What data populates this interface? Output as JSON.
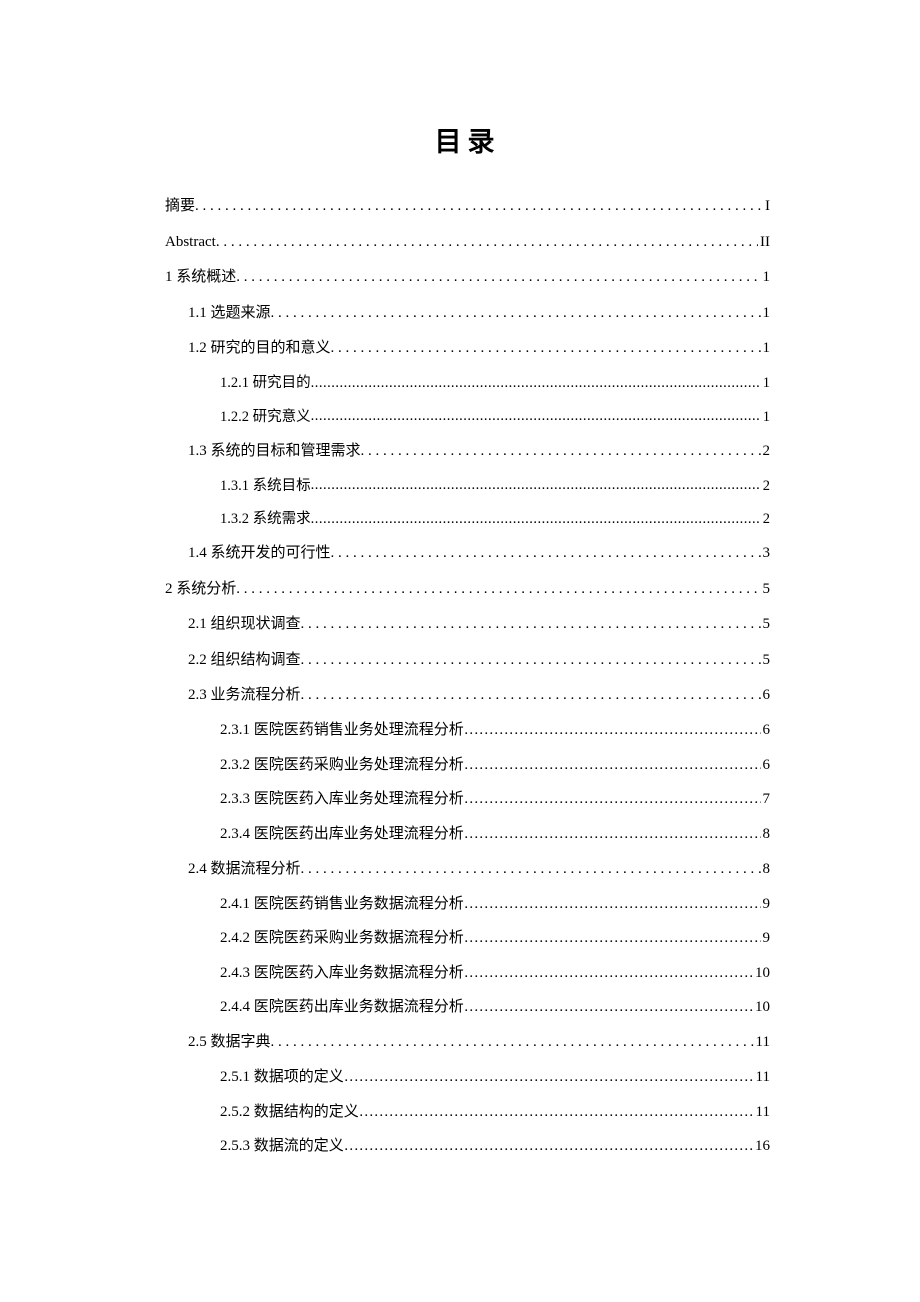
{
  "title": "目录",
  "entries": [
    {
      "label": "摘要",
      "page": "I",
      "level": "level-0",
      "leader": "leader-wide",
      "labelClass": ""
    },
    {
      "label": "Abstract",
      "page": "II",
      "level": "level-0",
      "leader": "leader-wide",
      "labelClass": "abstract-label"
    },
    {
      "label": "1  系统概述",
      "page": "1",
      "level": "level-0",
      "leader": "leader-wide",
      "labelClass": ""
    },
    {
      "label": "1.1 选题来源",
      "page": "1",
      "level": "level-1",
      "leader": "leader-wide",
      "labelClass": ""
    },
    {
      "label": "1.2 研究的目的和意义",
      "page": "1",
      "level": "level-1",
      "leader": "leader-wide",
      "labelClass": ""
    },
    {
      "label": "1.2.1 研究目的",
      "page": "1",
      "level": "level-2-dense",
      "leader": "leader-tight",
      "labelClass": ""
    },
    {
      "label": "1.2.2 研究意义",
      "page": "1",
      "level": "level-2-dense",
      "leader": "leader-tight",
      "labelClass": ""
    },
    {
      "label": "1.3 系统的目标和管理需求",
      "page": "2",
      "level": "level-1",
      "leader": "leader-wide",
      "labelClass": ""
    },
    {
      "label": "1.3.1 系统目标",
      "page": "2",
      "level": "level-2-dense",
      "leader": "leader-tight",
      "labelClass": ""
    },
    {
      "label": "1.3.2 系统需求",
      "page": "2",
      "level": "level-2-dense",
      "leader": "leader-tight",
      "labelClass": ""
    },
    {
      "label": "1.4 系统开发的可行性",
      "page": "3",
      "level": "level-1",
      "leader": "leader-wide",
      "labelClass": ""
    },
    {
      "label": "2  系统分析",
      "page": "5",
      "level": "level-0",
      "leader": "leader-wide",
      "labelClass": ""
    },
    {
      "label": "2.1 组织现状调查",
      "page": "5",
      "level": "level-1",
      "leader": "leader-wide",
      "labelClass": ""
    },
    {
      "label": "2.2 组织结构调查",
      "page": "5",
      "level": "level-1",
      "leader": "leader-wide",
      "labelClass": ""
    },
    {
      "label": "2.3 业务流程分析",
      "page": "6",
      "level": "level-1",
      "leader": "leader-wide",
      "labelClass": ""
    },
    {
      "label": "2.3.1 医院医药销售业务处理流程分析",
      "page": "6",
      "level": "level-2",
      "leader": "leader-chinese",
      "labelClass": ""
    },
    {
      "label": "2.3.2 医院医药采购业务处理流程分析",
      "page": "6",
      "level": "level-2",
      "leader": "leader-chinese",
      "labelClass": ""
    },
    {
      "label": "2.3.3 医院医药入库业务处理流程分析",
      "page": "7",
      "level": "level-2",
      "leader": "leader-chinese",
      "labelClass": ""
    },
    {
      "label": "2.3.4 医院医药出库业务处理流程分析",
      "page": "8",
      "level": "level-2",
      "leader": "leader-chinese",
      "labelClass": ""
    },
    {
      "label": "2.4 数据流程分析",
      "page": "8",
      "level": "level-1",
      "leader": "leader-wide",
      "labelClass": ""
    },
    {
      "label": "2.4.1 医院医药销售业务数据流程分析",
      "page": "9",
      "level": "level-2",
      "leader": "leader-chinese",
      "labelClass": ""
    },
    {
      "label": "2.4.2 医院医药采购业务数据流程分析",
      "page": "9",
      "level": "level-2",
      "leader": "leader-chinese",
      "labelClass": ""
    },
    {
      "label": "2.4.3 医院医药入库业务数据流程分析",
      "page": "10",
      "level": "level-2",
      "leader": "leader-chinese",
      "labelClass": ""
    },
    {
      "label": "2.4.4 医院医药出库业务数据流程分析",
      "page": "10",
      "level": "level-2",
      "leader": "leader-chinese",
      "labelClass": ""
    },
    {
      "label": "2.5 数据字典",
      "page": "11",
      "level": "level-1",
      "leader": "leader-wide",
      "labelClass": ""
    },
    {
      "label": "2.5.1 数据项的定义",
      "page": "11",
      "level": "level-2",
      "leader": "leader-chinese-dot",
      "labelClass": ""
    },
    {
      "label": "2.5.2 数据结构的定义",
      "page": "11",
      "level": "level-2",
      "leader": "leader-chinese",
      "labelClass": ""
    },
    {
      "label": "2.5.3 数据流的定义",
      "page": "16",
      "level": "level-2",
      "leader": "leader-chinese-dot",
      "labelClass": ""
    }
  ]
}
